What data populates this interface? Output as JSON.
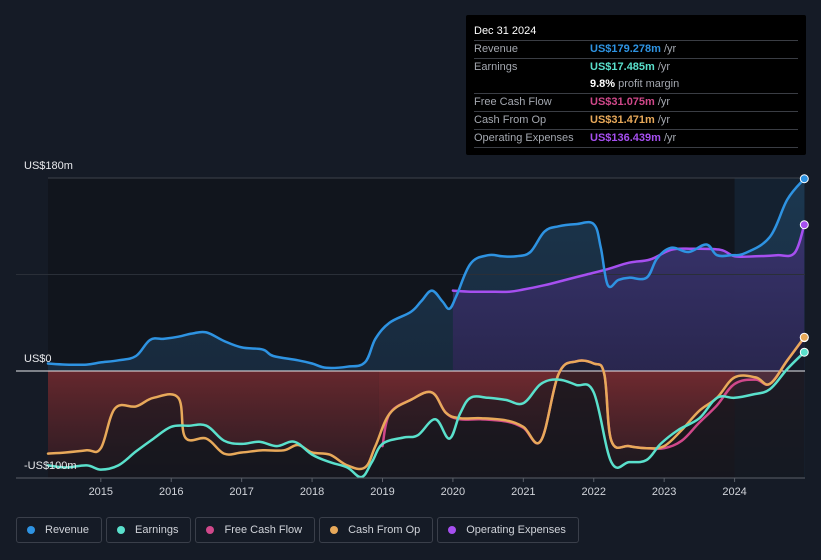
{
  "tooltip": {
    "date": "Dec 31 2024",
    "rows": [
      {
        "label": "Revenue",
        "value": "US$179.278m",
        "unit": "/yr",
        "color": "#2e93e2"
      },
      {
        "label": "Earnings",
        "value": "US$17.485m",
        "unit": "/yr",
        "color": "#5ae0cc"
      },
      {
        "label": "",
        "value": "9.8%",
        "unit": "profit margin",
        "color": "#ffffff"
      },
      {
        "label": "Free Cash Flow",
        "value": "US$31.075m",
        "unit": "/yr",
        "color": "#d0488a"
      },
      {
        "label": "Cash From Op",
        "value": "US$31.471m",
        "unit": "/yr",
        "color": "#e8a95a"
      },
      {
        "label": "Operating Expenses",
        "value": "US$136.439m",
        "unit": "/yr",
        "color": "#a64ff0"
      }
    ]
  },
  "legend": [
    {
      "label": "Revenue",
      "color": "#2e93e2"
    },
    {
      "label": "Earnings",
      "color": "#5ae0cc"
    },
    {
      "label": "Free Cash Flow",
      "color": "#d0488a"
    },
    {
      "label": "Cash From Op",
      "color": "#e8a95a"
    },
    {
      "label": "Operating Expenses",
      "color": "#a64ff0"
    }
  ],
  "chart_data": {
    "type": "area",
    "title": "",
    "xlabel": "",
    "ylabel": "",
    "y_tick_labels": [
      "US$180m",
      "US$0",
      "-US$100m"
    ],
    "ylim": [
      -100,
      180
    ],
    "xlim": [
      2014.25,
      2025.0
    ],
    "x_ticks": [
      "2015",
      "2016",
      "2017",
      "2018",
      "2019",
      "2020",
      "2021",
      "2022",
      "2023",
      "2024"
    ],
    "grid": true,
    "legend_position": "bottom",
    "highlight_past_year_from": 2024.0,
    "series": [
      {
        "name": "Revenue",
        "color": "#2e93e2",
        "points": [
          [
            2014.25,
            7
          ],
          [
            2014.5,
            6
          ],
          [
            2014.8,
            6
          ],
          [
            2015.0,
            8
          ],
          [
            2015.25,
            10
          ],
          [
            2015.5,
            14
          ],
          [
            2015.7,
            29
          ],
          [
            2015.9,
            30
          ],
          [
            2016.1,
            32
          ],
          [
            2016.3,
            35
          ],
          [
            2016.5,
            36
          ],
          [
            2016.75,
            28
          ],
          [
            2017.0,
            22
          ],
          [
            2017.3,
            20
          ],
          [
            2017.45,
            14
          ],
          [
            2017.8,
            10
          ],
          [
            2018.0,
            7
          ],
          [
            2018.2,
            3
          ],
          [
            2018.5,
            4
          ],
          [
            2018.75,
            8
          ],
          [
            2018.9,
            30
          ],
          [
            2019.1,
            45
          ],
          [
            2019.4,
            55
          ],
          [
            2019.55,
            65
          ],
          [
            2019.7,
            75
          ],
          [
            2019.85,
            65
          ],
          [
            2019.95,
            58
          ],
          [
            2020.05,
            70
          ],
          [
            2020.25,
            100
          ],
          [
            2020.5,
            108
          ],
          [
            2020.7,
            107
          ],
          [
            2020.9,
            107
          ],
          [
            2021.1,
            111
          ],
          [
            2021.3,
            130
          ],
          [
            2021.5,
            135
          ],
          [
            2021.75,
            137
          ],
          [
            2022.0,
            137
          ],
          [
            2022.1,
            115
          ],
          [
            2022.2,
            80
          ],
          [
            2022.35,
            85
          ],
          [
            2022.5,
            87
          ],
          [
            2022.75,
            87
          ],
          [
            2022.9,
            105
          ],
          [
            2023.1,
            115
          ],
          [
            2023.35,
            111
          ],
          [
            2023.6,
            118
          ],
          [
            2023.75,
            108
          ],
          [
            2023.95,
            108
          ],
          [
            2024.15,
            110
          ],
          [
            2024.5,
            125
          ],
          [
            2024.75,
            160
          ],
          [
            2024.99,
            179.3
          ]
        ]
      },
      {
        "name": "Operating Expenses",
        "color": "#a64ff0",
        "points": [
          [
            2020.0,
            75
          ],
          [
            2020.25,
            74
          ],
          [
            2020.5,
            74
          ],
          [
            2020.8,
            74
          ],
          [
            2021.0,
            76
          ],
          [
            2021.3,
            80
          ],
          [
            2021.6,
            85
          ],
          [
            2021.9,
            90
          ],
          [
            2022.2,
            95
          ],
          [
            2022.5,
            101
          ],
          [
            2022.8,
            104
          ],
          [
            2023.1,
            113
          ],
          [
            2023.4,
            114
          ],
          [
            2023.8,
            113
          ],
          [
            2024.0,
            107
          ],
          [
            2024.3,
            107
          ],
          [
            2024.6,
            108
          ],
          [
            2024.85,
            110
          ],
          [
            2024.99,
            136.4
          ]
        ]
      },
      {
        "name": "Earnings",
        "color": "#5ae0cc",
        "points": [
          [
            2014.25,
            -88
          ],
          [
            2014.5,
            -90
          ],
          [
            2014.8,
            -88
          ],
          [
            2015.0,
            -92
          ],
          [
            2015.25,
            -88
          ],
          [
            2015.5,
            -75
          ],
          [
            2015.75,
            -63
          ],
          [
            2016.0,
            -52
          ],
          [
            2016.25,
            -51
          ],
          [
            2016.5,
            -51
          ],
          [
            2016.75,
            -65
          ],
          [
            2017.0,
            -68
          ],
          [
            2017.25,
            -66
          ],
          [
            2017.5,
            -70
          ],
          [
            2017.75,
            -66
          ],
          [
            2018.0,
            -78
          ],
          [
            2018.25,
            -85
          ],
          [
            2018.5,
            -90
          ],
          [
            2018.7,
            -99
          ],
          [
            2018.85,
            -85
          ],
          [
            2019.0,
            -68
          ],
          [
            2019.3,
            -62
          ],
          [
            2019.5,
            -60
          ],
          [
            2019.75,
            -45
          ],
          [
            2019.95,
            -63
          ],
          [
            2020.1,
            -40
          ],
          [
            2020.25,
            -25
          ],
          [
            2020.5,
            -25
          ],
          [
            2020.75,
            -27
          ],
          [
            2021.0,
            -30
          ],
          [
            2021.25,
            -12
          ],
          [
            2021.5,
            -8
          ],
          [
            2021.75,
            -13
          ],
          [
            2022.0,
            -20
          ],
          [
            2022.25,
            -85
          ],
          [
            2022.5,
            -85
          ],
          [
            2022.75,
            -83
          ],
          [
            2022.95,
            -68
          ],
          [
            2023.2,
            -55
          ],
          [
            2023.5,
            -44
          ],
          [
            2023.75,
            -25
          ],
          [
            2024.0,
            -25
          ],
          [
            2024.25,
            -22
          ],
          [
            2024.5,
            -17
          ],
          [
            2024.75,
            2
          ],
          [
            2024.99,
            17.5
          ]
        ]
      },
      {
        "name": "Cash From Op",
        "color": "#e8a95a",
        "points": [
          [
            2014.25,
            -77
          ],
          [
            2014.5,
            -76
          ],
          [
            2014.8,
            -74
          ],
          [
            2015.0,
            -72
          ],
          [
            2015.2,
            -35
          ],
          [
            2015.5,
            -33
          ],
          [
            2015.75,
            -25
          ],
          [
            2016.1,
            -25
          ],
          [
            2016.2,
            -62
          ],
          [
            2016.5,
            -63
          ],
          [
            2016.75,
            -77
          ],
          [
            2017.0,
            -76
          ],
          [
            2017.3,
            -74
          ],
          [
            2017.6,
            -74
          ],
          [
            2017.8,
            -69
          ],
          [
            2018.0,
            -76
          ],
          [
            2018.25,
            -78
          ],
          [
            2018.5,
            -88
          ],
          [
            2018.75,
            -90
          ],
          [
            2018.9,
            -70
          ],
          [
            2019.1,
            -40
          ],
          [
            2019.4,
            -27
          ],
          [
            2019.7,
            -20
          ],
          [
            2019.9,
            -39
          ],
          [
            2020.1,
            -44
          ],
          [
            2020.4,
            -44
          ],
          [
            2020.75,
            -46
          ],
          [
            2021.0,
            -52
          ],
          [
            2021.25,
            -65
          ],
          [
            2021.5,
            -3
          ],
          [
            2021.75,
            9
          ],
          [
            2022.0,
            7
          ],
          [
            2022.15,
            -3
          ],
          [
            2022.25,
            -65
          ],
          [
            2022.5,
            -70
          ],
          [
            2022.75,
            -72
          ],
          [
            2023.0,
            -70
          ],
          [
            2023.25,
            -55
          ],
          [
            2023.5,
            -37
          ],
          [
            2023.75,
            -25
          ],
          [
            2024.0,
            -6
          ],
          [
            2024.3,
            -6
          ],
          [
            2024.5,
            -12
          ],
          [
            2024.75,
            10
          ],
          [
            2024.99,
            31.5
          ]
        ]
      },
      {
        "name": "Free Cash Flow",
        "color": "#d0488a",
        "points": [
          [
            2019.0,
            -70
          ],
          [
            2019.1,
            -40
          ],
          [
            2019.4,
            -27
          ],
          [
            2019.7,
            -20
          ],
          [
            2019.9,
            -39
          ],
          [
            2020.1,
            -45
          ],
          [
            2020.4,
            -45
          ],
          [
            2020.75,
            -47
          ],
          [
            2021.0,
            -53
          ],
          [
            2021.25,
            -65
          ],
          [
            2021.5,
            -3
          ],
          [
            2021.75,
            9
          ],
          [
            2022.0,
            7
          ],
          [
            2022.15,
            -3
          ],
          [
            2022.25,
            -65
          ],
          [
            2022.5,
            -70
          ],
          [
            2022.75,
            -72
          ],
          [
            2023.0,
            -72
          ],
          [
            2023.25,
            -65
          ],
          [
            2023.5,
            -48
          ],
          [
            2023.75,
            -32
          ],
          [
            2024.0,
            -12
          ],
          [
            2024.3,
            -8
          ],
          [
            2024.5,
            -12
          ],
          [
            2024.75,
            10
          ],
          [
            2024.99,
            31.1
          ]
        ]
      }
    ]
  }
}
